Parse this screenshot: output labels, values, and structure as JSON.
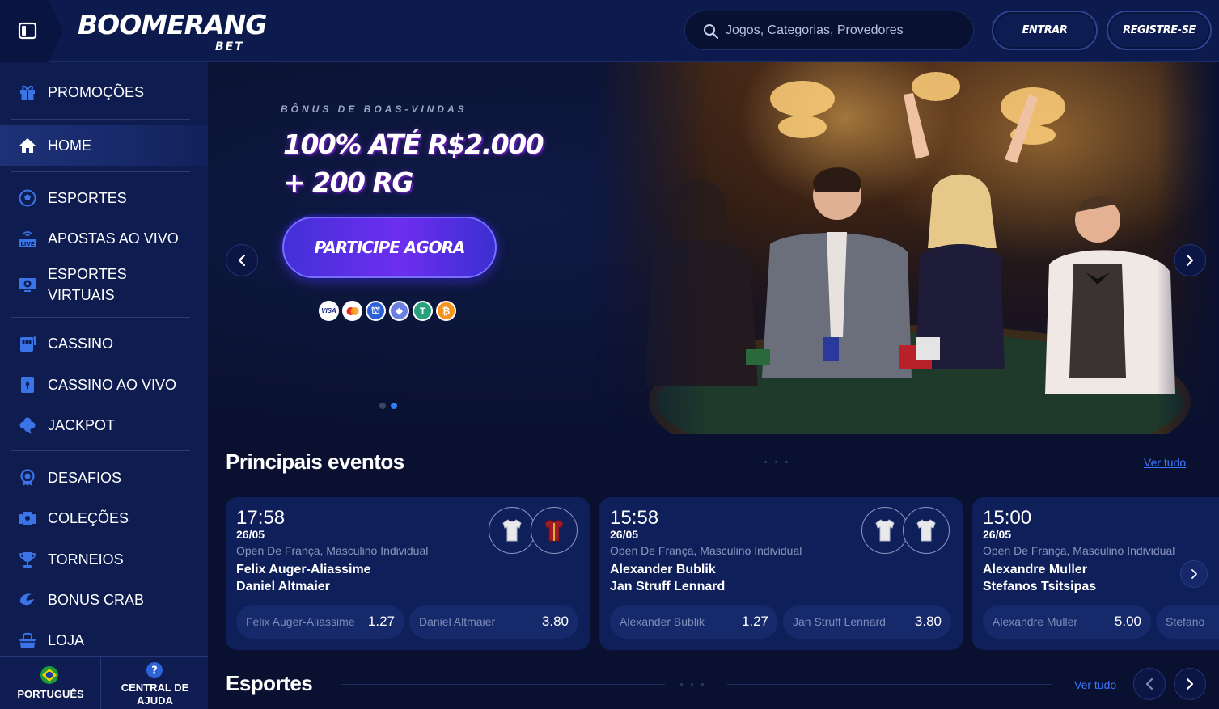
{
  "header": {
    "logo": "BOOMERANG",
    "logo_sub": "BET",
    "search_placeholder": "Jogos, Categorias, Provedores",
    "login_label": "ENTRAR",
    "register_label": "REGISTRE-SE"
  },
  "sidebar": {
    "items": [
      {
        "label": "PROMOÇÕES",
        "icon": "gift-icon"
      },
      {
        "label": "HOME",
        "icon": "home-icon",
        "active": true
      },
      {
        "label": "ESPORTES",
        "icon": "soccer-ball-icon"
      },
      {
        "label": "APOSTAS AO VIVO",
        "icon": "live-icon"
      },
      {
        "label": "ESPORTES VIRTUAIS",
        "icon": "virtual-sports-icon"
      },
      {
        "label": "CASSINO",
        "icon": "slot-machine-icon"
      },
      {
        "label": "CASSINO AO VIVO",
        "icon": "live-casino-icon"
      },
      {
        "label": "JACKPOT",
        "icon": "clover-icon"
      },
      {
        "label": "DESAFIOS",
        "icon": "medal-icon"
      },
      {
        "label": "COLEÇÕES",
        "icon": "collections-icon"
      },
      {
        "label": "TORNEIOS",
        "icon": "trophy-icon"
      },
      {
        "label": "BONUS CRAB",
        "icon": "crab-icon"
      },
      {
        "label": "LOJA",
        "icon": "shop-icon"
      }
    ],
    "footer": {
      "language": "PORTUGUÊS",
      "help": "CENTRAL DE AJUDA"
    }
  },
  "banner": {
    "kicker": "BÔNUS DE BOAS-VINDAS",
    "title_line1": "100% ATÉ R$2.000",
    "title_line2": "+ 200 RG",
    "cta": "PARTICIPE AGORA",
    "payments": [
      {
        "name": "visa-icon",
        "text": "VISA"
      },
      {
        "name": "mastercard-icon",
        "text": ""
      },
      {
        "name": "bank-icon",
        "text": "⛫"
      },
      {
        "name": "ethereum-icon",
        "text": "◆"
      },
      {
        "name": "tether-icon",
        "text": "T"
      },
      {
        "name": "bitcoin-icon",
        "text": "₿"
      }
    ]
  },
  "events": {
    "title": "Principais eventos",
    "see_all": "Ver tudo",
    "cards": [
      {
        "time": "17:58",
        "date": "26/05",
        "competition": "Open De França, Masculino Individual",
        "player1": "Felix Auger-Aliassime",
        "player2": "Daniel Altmaier",
        "odds": [
          {
            "name": "Felix Auger-Aliassime",
            "value": "1.27"
          },
          {
            "name": "Daniel Altmaier",
            "value": "3.80"
          }
        ]
      },
      {
        "time": "15:58",
        "date": "26/05",
        "competition": "Open De França, Masculino Individual",
        "player1": "Alexander Bublik",
        "player2": "Jan Struff Lennard",
        "odds": [
          {
            "name": "Alexander Bublik",
            "value": "1.27"
          },
          {
            "name": "Jan Struff Lennard",
            "value": "3.80"
          }
        ]
      },
      {
        "time": "15:00",
        "date": "26/05",
        "competition": "Open De França, Masculino Individual",
        "player1": "Alexandre Muller",
        "player2": "Stefanos Tsitsipas",
        "odds": [
          {
            "name": "Alexandre Muller",
            "value": "5.00"
          },
          {
            "name": "Stefano",
            "value": ""
          }
        ]
      }
    ]
  },
  "sports": {
    "title": "Esportes",
    "see_all": "Ver tudo"
  },
  "colors": {
    "header_bg": "#0d1a4e",
    "sidebar_bg": "#0e1c50",
    "page_bg": "#0a1130",
    "card_bg": "#0f1f5a",
    "link": "#3a78ff",
    "cta_gradient_start": "#4330d8",
    "cta_gradient_end": "#6e2ef0"
  }
}
